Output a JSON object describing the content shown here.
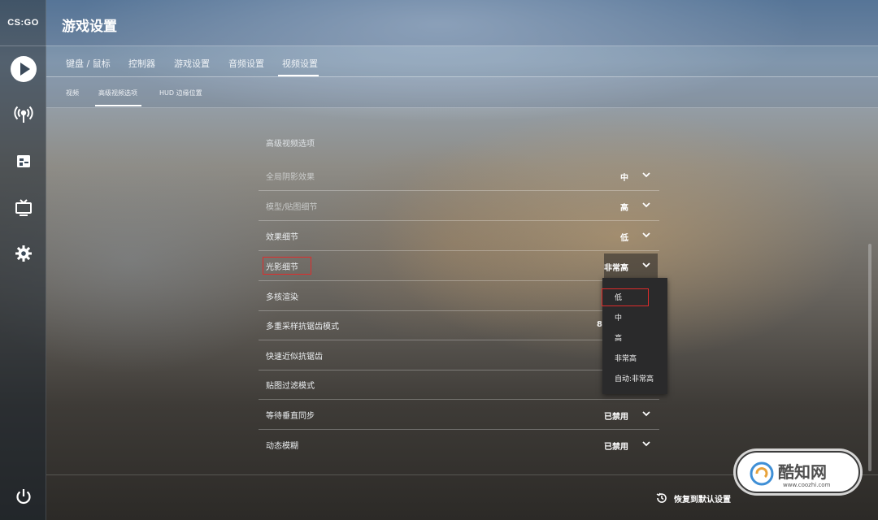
{
  "app": {
    "logo_text": "CS:GO"
  },
  "sidebar": {
    "items": [
      {
        "icon": "play-icon"
      },
      {
        "icon": "broadcast-icon"
      },
      {
        "icon": "inventory-icon"
      },
      {
        "icon": "tv-icon"
      },
      {
        "icon": "gear-icon"
      },
      {
        "icon": "power-icon"
      }
    ]
  },
  "header": {
    "title": "游戏设置"
  },
  "tabs": [
    "键盘 / 鼠标",
    "控制器",
    "游戏设置",
    "音频设置",
    "视频设置"
  ],
  "active_tab": "视频设置",
  "subtabs": [
    "视频",
    "高级视频选项",
    "HUD 边缘位置"
  ],
  "active_subtab": "高级视频选项",
  "section": {
    "title": "高级视频选项"
  },
  "settings": [
    {
      "label": "全局阴影效果",
      "value": "中"
    },
    {
      "label": "模型/贴图细节",
      "value": "高"
    },
    {
      "label": "效果细节",
      "value": "低"
    },
    {
      "label": "光影细节",
      "value": "非常高"
    },
    {
      "label": "多核渲染",
      "value": ""
    },
    {
      "label": "多重采样抗锯齿模式",
      "value": "8"
    },
    {
      "label": "快速近似抗锯齿",
      "value": ""
    },
    {
      "label": "贴图过滤模式",
      "value": ""
    },
    {
      "label": "等待垂直同步",
      "value": "已禁用"
    },
    {
      "label": "动态模糊",
      "value": "已禁用"
    }
  ],
  "dropdown": {
    "options": [
      "低",
      "中",
      "高",
      "非常高",
      "自动:非常高"
    ]
  },
  "footer": {
    "restore_label": "恢复到默认设置"
  },
  "watermark": {
    "text": "酷知网",
    "url": "www.coozhi.com"
  },
  "colors": {
    "highlight_box": "#e02b2b",
    "dropdown_bg": "#2a2a2b"
  }
}
